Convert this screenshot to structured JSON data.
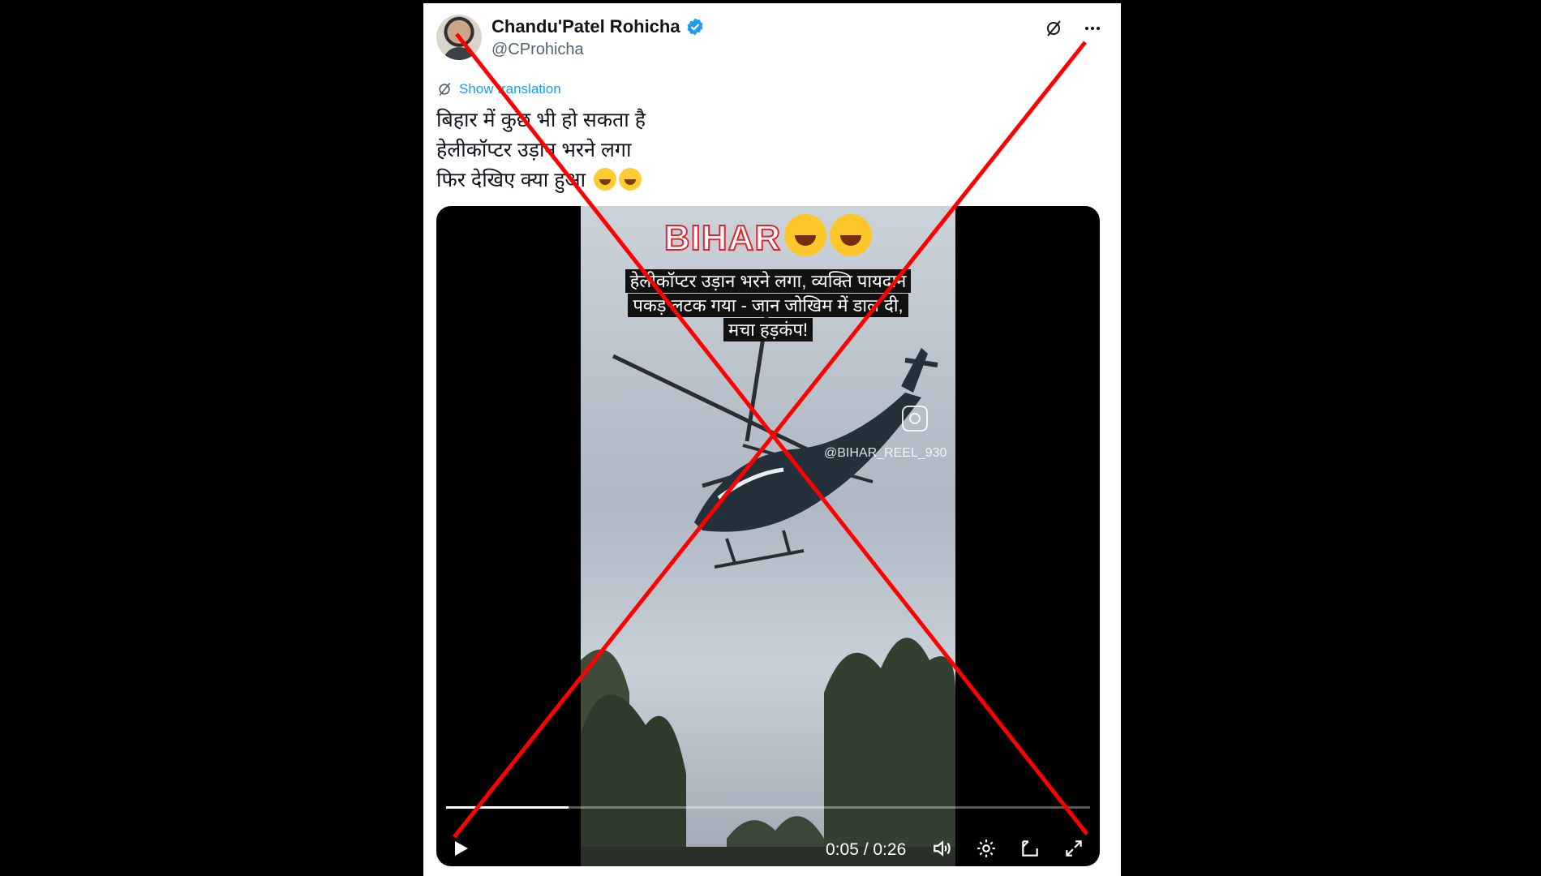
{
  "tweet": {
    "author_name": "Chandu'Patel Rohicha",
    "handle": "@CProhicha",
    "show_translation": "Show translation",
    "text_lines": [
      "बिहार में कुछ भी हो सकता है",
      "हेलीकॉप्टर उड़ान भरने लगा",
      "फिर देखिए क्या हुआ"
    ]
  },
  "video": {
    "overlay_title": "BIHAR",
    "caption": "हेलीकॉप्टर उड़ान भरने लगा, व्यक्ति पायदान पकड़ लटक गया - जान जोखिम में डाल दी, मचा हड़कंप!",
    "watermark": "@BIHAR_REEL_930",
    "time_display": "0:05 / 0:26",
    "progress": 0.19
  },
  "colors": {
    "verified": "#1d9bf0",
    "cross": "#ff0000",
    "link": "#1d9bf0"
  },
  "icons": {
    "grok": "grok-icon",
    "more": "more-icon",
    "translate": "translate-icon",
    "play": "play-icon",
    "volume": "volume-icon",
    "settings": "settings-icon",
    "pip": "picture-in-picture-icon",
    "fullscreen": "fullscreen-icon"
  }
}
